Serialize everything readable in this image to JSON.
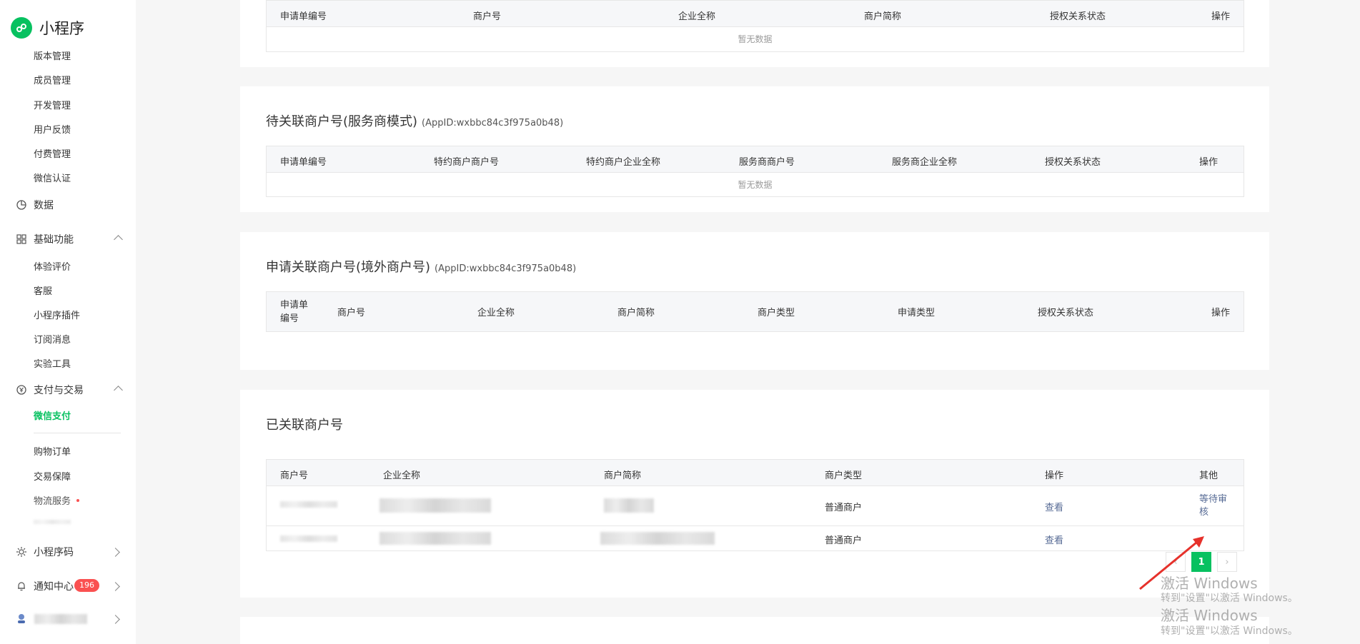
{
  "sidebar": {
    "app_title": "小程序",
    "sub_items_top": [
      "版本管理",
      "成员管理",
      "开发管理",
      "用户反馈",
      "付费管理",
      "微信认证"
    ],
    "group_data": "数据",
    "group_basic": "基础功能",
    "basic_items": [
      "体验评价",
      "客服",
      "小程序插件",
      "订阅消息",
      "实验工具"
    ],
    "group_pay": "支付与交易",
    "pay_active": "微信支付",
    "pay_items": [
      "购物订单",
      "交易保障",
      "物流服务"
    ],
    "group_code": "小程序码",
    "group_notice": "通知中心",
    "notice_count": "196"
  },
  "panel1": {
    "headers": [
      "申请单编号",
      "商户号",
      "企业全称",
      "商户简称",
      "授权关系状态",
      "操作"
    ],
    "empty_text": "暂无数据"
  },
  "panel2": {
    "title": "待关联商户号(服务商模式)",
    "appid": "(AppID:wxbbc84c3f975a0b48)",
    "headers": [
      "申请单编号",
      "特约商户商户号",
      "特约商户企业全称",
      "服务商商户号",
      "服务商企业全称",
      "授权关系状态",
      "操作"
    ],
    "empty_text": "暂无数据"
  },
  "panel3": {
    "title": "申请关联商户号(境外商户号)",
    "appid": "(AppID:wxbbc84c3f975a0b48)",
    "headers": [
      "申请单编号",
      "商户号",
      "企业全称",
      "商户简称",
      "商户类型",
      "申请类型",
      "授权关系状态",
      "操作"
    ]
  },
  "panel4": {
    "title": "已关联商户号",
    "headers": [
      "商户号",
      "企业全称",
      "商户简称",
      "商户类型",
      "操作",
      "其他"
    ],
    "rows": [
      {
        "type": "普通商户",
        "action": "查看",
        "other": "等待审核"
      },
      {
        "type": "普通商户",
        "action": "查看",
        "other": ""
      }
    ],
    "current_page": "1"
  },
  "watermark": {
    "line1": "激活 Windows",
    "line2": "转到\"设置\"以激活 Windows。"
  },
  "colors": {
    "brand_green": "#07c160",
    "link_blue": "#576b95",
    "badge_red": "#fa5151",
    "annotation_red": "#e6312b"
  }
}
